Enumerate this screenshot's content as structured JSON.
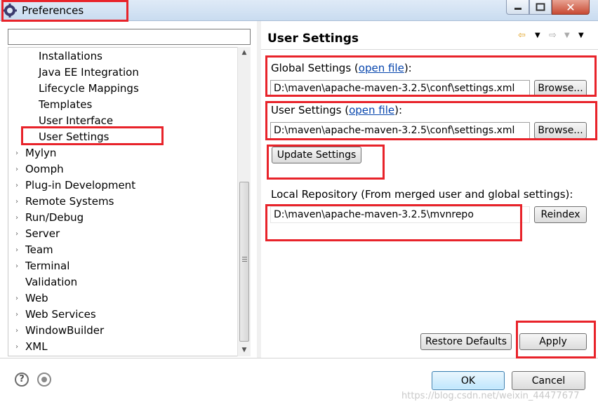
{
  "window": {
    "title": "Preferences",
    "icon": "eclipse-gear-icon"
  },
  "filter": {
    "value": "",
    "placeholder": ""
  },
  "tree": {
    "items": [
      {
        "label": "Installations",
        "expandable": false
      },
      {
        "label": "Java EE Integration",
        "expandable": false
      },
      {
        "label": "Lifecycle Mappings",
        "expandable": false
      },
      {
        "label": "Templates",
        "expandable": false
      },
      {
        "label": "User Interface",
        "expandable": false
      },
      {
        "label": "User Settings",
        "expandable": false,
        "selected": true
      },
      {
        "label": "Mylyn",
        "expandable": true
      },
      {
        "label": "Oomph",
        "expandable": true
      },
      {
        "label": "Plug-in Development",
        "expandable": true
      },
      {
        "label": "Remote Systems",
        "expandable": true
      },
      {
        "label": "Run/Debug",
        "expandable": true
      },
      {
        "label": "Server",
        "expandable": true
      },
      {
        "label": "Team",
        "expandable": true
      },
      {
        "label": "Terminal",
        "expandable": true
      },
      {
        "label": "Validation",
        "expandable": false
      },
      {
        "label": "Web",
        "expandable": true
      },
      {
        "label": "Web Services",
        "expandable": true
      },
      {
        "label": "WindowBuilder",
        "expandable": true
      },
      {
        "label": "XML",
        "expandable": true
      }
    ]
  },
  "page": {
    "title": "User Settings",
    "global": {
      "label_prefix": "Global Settings (",
      "link": "open file",
      "label_suffix": "):",
      "path": "D:\\maven\\apache-maven-3.2.5\\conf\\settings.xml",
      "browse": "Browse..."
    },
    "user": {
      "label_prefix": "User Settings (",
      "link": "open file",
      "label_suffix": "):",
      "path": "D:\\maven\\apache-maven-3.2.5\\conf\\settings.xml",
      "browse": "Browse..."
    },
    "update_button": "Update Settings",
    "local_repo": {
      "label": "Local Repository (From merged user and global settings):",
      "path": "D:\\maven\\apache-maven-3.2.5\\mvnrepo",
      "reindex": "Reindex"
    },
    "restore_defaults": "Restore Defaults",
    "apply": "Apply"
  },
  "footer": {
    "ok": "OK",
    "cancel": "Cancel",
    "watermark": "https://blog.csdn.net/weixin_44477677"
  },
  "colors": {
    "highlight": "#e8232a",
    "link": "#0645ad",
    "titlebar": "#c9dcf0"
  }
}
